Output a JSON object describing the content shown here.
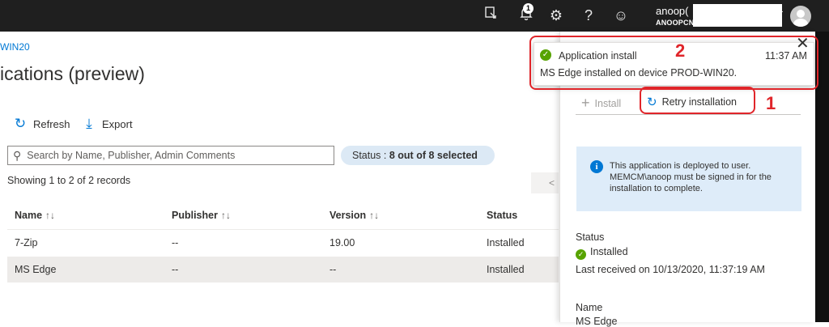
{
  "topbar": {
    "notification_count": "1",
    "account_name": "anoop(",
    "account_sub": "ANOOPCN",
    "account_more": "···",
    "icons": [
      "remote-device-icon",
      "bell-icon",
      "gear-icon",
      "help-icon",
      "smiley-icon",
      "avatar-icon"
    ]
  },
  "main": {
    "breadcrumb": "WIN20",
    "title": "ications (preview)",
    "toolbar": {
      "refresh": "Refresh",
      "export": "Export"
    },
    "search_placeholder": "Search by Name, Publisher, Admin Comments",
    "status_label": "Status : ",
    "status_value": "8 out of 8 selected",
    "records_text": "Showing 1 to 2 of 2 records",
    "pager_prev": "<",
    "columns": [
      "Name",
      "Publisher",
      "Version",
      "Status"
    ],
    "sort_arrows": {
      "name": "↑↓",
      "publisher": "↑↓",
      "version": "↑↓"
    },
    "rows": [
      {
        "name": "7-Zip",
        "publisher": "--",
        "version": "19.00",
        "status": "Installed"
      },
      {
        "name": "MS Edge",
        "publisher": "--",
        "version": "--",
        "status": "Installed"
      }
    ]
  },
  "panel": {
    "install_label": "Install",
    "retry_label": "Retry installation",
    "info_text": "This application is deployed to user. MEMCM\\anoop must be signed in for the installation to complete.",
    "status_heading": "Status",
    "status_value": "Installed",
    "last_received": "Last received on 10/13/2020, 11:37:19 AM",
    "name_heading": "Name",
    "name_value": "MS Edge"
  },
  "toast": {
    "title": "Application install",
    "time": "11:37 AM",
    "body": "MS Edge installed on device PROD-WIN20.",
    "close": "✕"
  },
  "annotations": {
    "label_1": "1",
    "label_2": "2",
    "color": "#e0252a"
  },
  "colors": {
    "accent": "#0078d4",
    "success": "#57a300",
    "topbar": "#1f1f1f"
  }
}
